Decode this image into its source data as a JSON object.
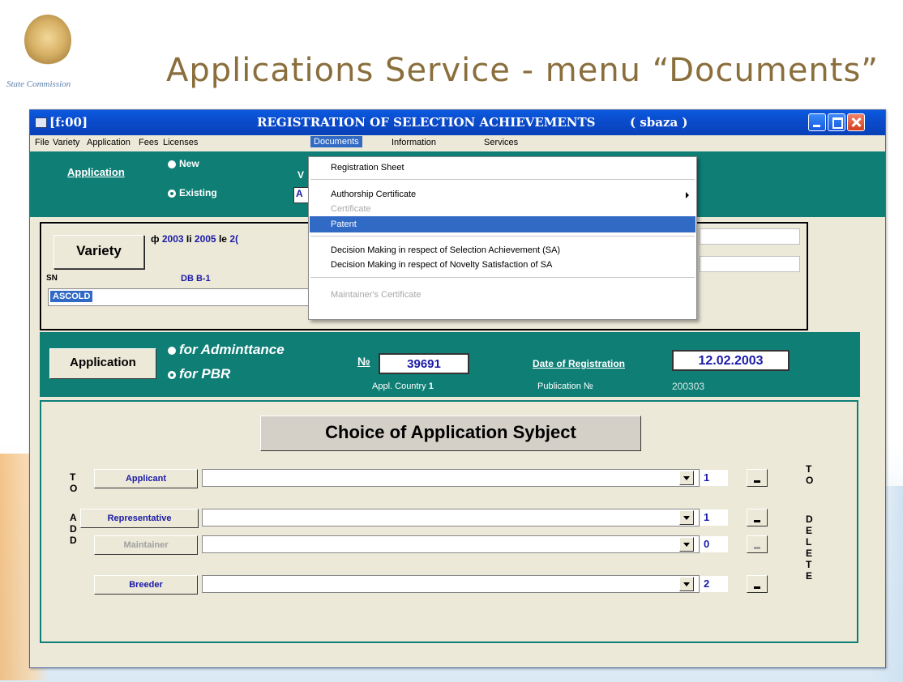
{
  "slide": {
    "title": "Applications  Service - menu “Documents”",
    "logo_caption": "State Commission"
  },
  "window": {
    "code": "[f:00]",
    "title": "REGISTRATION OF SELECTION ACHIEVEMENTS",
    "db": "( sbaza )"
  },
  "menu": {
    "items": [
      "File",
      "Variety",
      "Application",
      "Fees",
      "Licenses",
      "Documents",
      "Information",
      "Services"
    ],
    "active": "Documents"
  },
  "dropdown": {
    "items": [
      {
        "label": "Registration Sheet",
        "state": "normal"
      },
      {
        "label": "Authorship  Certificate",
        "state": "normal",
        "submenu": true
      },
      {
        "label": "Certificate",
        "state": "disabled"
      },
      {
        "label": "Patent",
        "state": "highlighted"
      },
      {
        "label": "Decision Making in respect of Selection Achievement (SA)",
        "state": "normal"
      },
      {
        "label": "Decision Making in respect of Novelty Satisfaction of SA",
        "state": "normal"
      },
      {
        "label": "Maintainer's  Certificate",
        "state": "disabled"
      }
    ]
  },
  "top_panel": {
    "application_label": "Application",
    "radio_new": "New",
    "radio_existing": "Existing",
    "v_label": "V",
    "stub_value": "A"
  },
  "variety_panel": {
    "button": "Variety",
    "year_prefix_1": "ф",
    "year_1": "2003",
    "year_prefix_2": "Ii",
    "year_2": "2005",
    "year_prefix_3": "le",
    "year_3": "2(",
    "sn_label": "SN",
    "sn_value": "DB B-1",
    "name_value": "ASCOLD"
  },
  "application_panel": {
    "button": "Application",
    "radio_admittance": "for Adminttance",
    "radio_pbr": "for PBR",
    "number_label": "№",
    "number_value": "39691",
    "country_label": "Appl. Country",
    "country_value": "1",
    "date_label": "Date of Registration",
    "date_value": "12.02.2003",
    "publication_label": "Publication  №",
    "publication_value": "200303"
  },
  "subject_panel": {
    "title": "Choice of Application Sybject",
    "left_letters": [
      "T",
      "O",
      "A",
      "D",
      "D"
    ],
    "right_letters": [
      "T",
      "O",
      "D",
      "E",
      "L",
      "E",
      "T",
      "E"
    ],
    "rows": [
      {
        "label": "Applicant",
        "count": "1",
        "enabled": true
      },
      {
        "label": "Representative",
        "count": "1",
        "enabled": true
      },
      {
        "label": "Maintainer",
        "count": "0",
        "enabled": false
      },
      {
        "label": "Breeder",
        "count": "2",
        "enabled": true
      }
    ]
  },
  "colors": {
    "panel_teal": "#0f7f76",
    "title_blue": "#0b4ccd",
    "value_blue": "#1a1aa8",
    "menu_highlight": "#316ac5",
    "slide_title": "#8a6e3c"
  }
}
